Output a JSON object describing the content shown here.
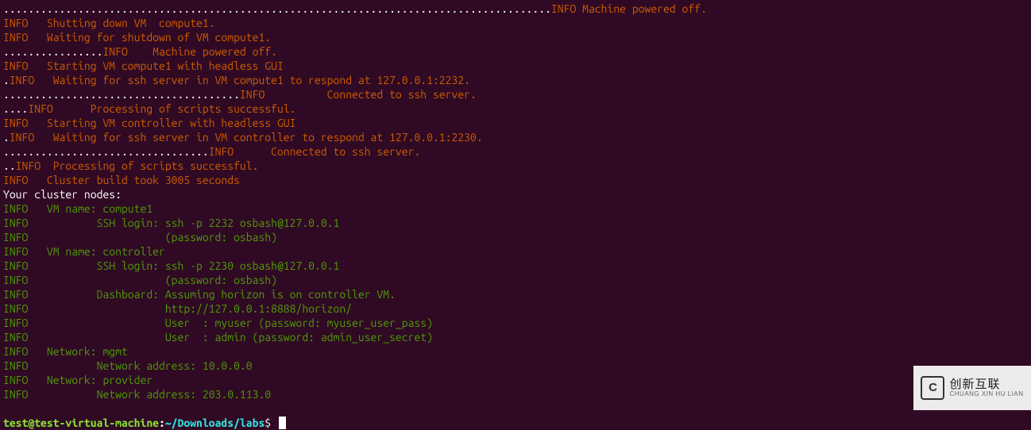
{
  "lines": [
    {
      "segments": [
        {
          "cls": "white",
          "text": "........................................................................................"
        },
        {
          "cls": "orange",
          "text": "INFO Machine powered off."
        }
      ]
    },
    {
      "segments": [
        {
          "cls": "orange",
          "text": "INFO   Shutting down VM  compute1."
        }
      ]
    },
    {
      "segments": [
        {
          "cls": "orange",
          "text": "INFO   Waiting for shutdown of VM compute1."
        }
      ]
    },
    {
      "segments": [
        {
          "cls": "white",
          "text": "................"
        },
        {
          "cls": "orange",
          "text": "INFO    Machine powered off."
        }
      ]
    },
    {
      "segments": [
        {
          "cls": "orange",
          "text": "INFO   Starting VM compute1 with headless GUI"
        }
      ]
    },
    {
      "segments": [
        {
          "cls": "white",
          "text": "."
        },
        {
          "cls": "orange",
          "text": "INFO   Waiting for ssh server in VM compute1 to respond at 127.0.0.1:2232."
        }
      ]
    },
    {
      "segments": [
        {
          "cls": "white",
          "text": "......................................"
        },
        {
          "cls": "orange",
          "text": "INFO          Connected to ssh server."
        }
      ]
    },
    {
      "segments": [
        {
          "cls": "white",
          "text": "...."
        },
        {
          "cls": "orange",
          "text": "INFO      Processing of scripts successful."
        }
      ]
    },
    {
      "segments": [
        {
          "cls": "orange",
          "text": "INFO   Starting VM controller with headless GUI"
        }
      ]
    },
    {
      "segments": [
        {
          "cls": "white",
          "text": "."
        },
        {
          "cls": "orange",
          "text": "INFO   Waiting for ssh server in VM controller to respond at 127.0.0.1:2230."
        }
      ]
    },
    {
      "segments": [
        {
          "cls": "white",
          "text": "................................."
        },
        {
          "cls": "orange",
          "text": "INFO      Connected to ssh server."
        }
      ]
    },
    {
      "segments": [
        {
          "cls": "white",
          "text": ".."
        },
        {
          "cls": "orange",
          "text": "INFO  Processing of scripts successful."
        }
      ]
    },
    {
      "segments": [
        {
          "cls": "orange",
          "text": "INFO   Cluster build took 3005 seconds"
        }
      ]
    },
    {
      "segments": [
        {
          "cls": "white",
          "text": "Your cluster nodes:"
        }
      ]
    },
    {
      "segments": [
        {
          "cls": "green",
          "text": "INFO   VM name: compute1"
        }
      ]
    },
    {
      "segments": [
        {
          "cls": "green",
          "text": "INFO           SSH login: ssh -p 2232 osbash@127.0.0.1"
        }
      ]
    },
    {
      "segments": [
        {
          "cls": "green",
          "text": "INFO                      (password: osbash)"
        }
      ]
    },
    {
      "segments": [
        {
          "cls": "green",
          "text": "INFO   VM name: controller"
        }
      ]
    },
    {
      "segments": [
        {
          "cls": "green",
          "text": "INFO           SSH login: ssh -p 2230 osbash@127.0.0.1"
        }
      ]
    },
    {
      "segments": [
        {
          "cls": "green",
          "text": "INFO                      (password: osbash)"
        }
      ]
    },
    {
      "segments": [
        {
          "cls": "green",
          "text": "INFO           Dashboard: Assuming horizon is on controller VM."
        }
      ]
    },
    {
      "segments": [
        {
          "cls": "green",
          "text": "INFO                      http://127.0.0.1:8888/horizon/"
        }
      ]
    },
    {
      "segments": [
        {
          "cls": "green",
          "text": "INFO                      User  : myuser (password: myuser_user_pass)"
        }
      ]
    },
    {
      "segments": [
        {
          "cls": "green",
          "text": "INFO                      User  : admin (password: admin_user_secret)"
        }
      ]
    },
    {
      "segments": [
        {
          "cls": "green",
          "text": "INFO   Network: mgmt"
        }
      ]
    },
    {
      "segments": [
        {
          "cls": "green",
          "text": "INFO           Network address: 10.0.0.0"
        }
      ]
    },
    {
      "segments": [
        {
          "cls": "green",
          "text": "INFO   Network: provider"
        }
      ]
    },
    {
      "segments": [
        {
          "cls": "green",
          "text": "INFO           Network address: 203.0.113.0"
        }
      ]
    }
  ],
  "prompt": {
    "user_host": "test@test-virtual-machine",
    "sep": ":",
    "path": "~/Downloads/labs",
    "dollar": "$"
  },
  "watermark": {
    "cn": "创新互联",
    "py": "CHUANG XIN HU LIAN"
  }
}
